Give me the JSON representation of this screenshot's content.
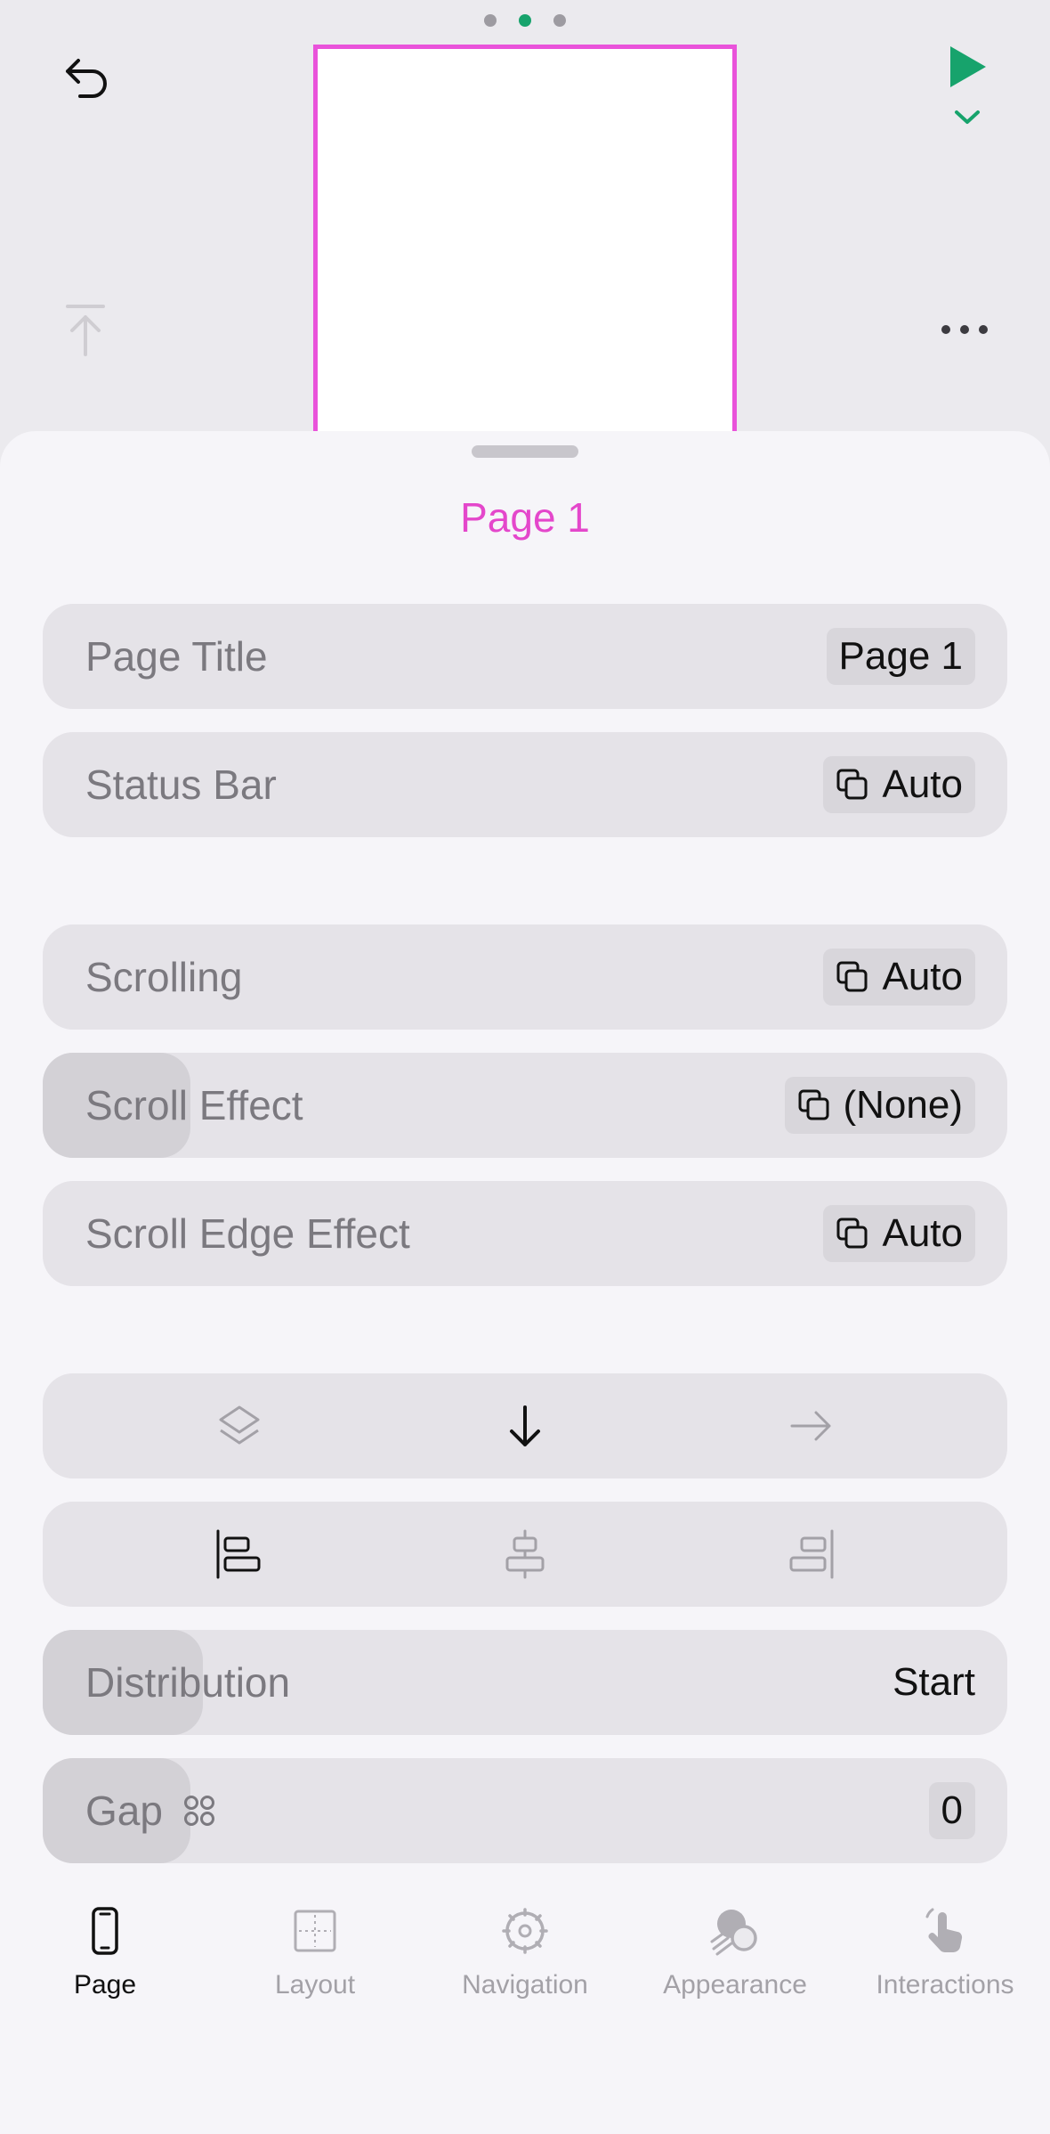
{
  "header": {
    "page_dots": [
      {
        "active": false
      },
      {
        "active": true
      },
      {
        "active": false
      }
    ],
    "undo_icon": "undo-arrow-icon",
    "play_icon": "play-icon",
    "export_icon": "arrow-up-to-line-icon",
    "more_icon": "ellipsis-icon"
  },
  "sheet": {
    "title": "Page 1",
    "page_title": {
      "label": "Page Title",
      "value": "Page 1"
    },
    "status_bar": {
      "label": "Status Bar",
      "value": "Auto"
    },
    "scrolling": {
      "label": "Scrolling",
      "value": "Auto"
    },
    "scroll_effect": {
      "label": "Scroll Effect",
      "value": "(None)"
    },
    "scroll_edge_effect": {
      "label": "Scroll Edge Effect",
      "value": "Auto"
    },
    "direction": {
      "options": [
        "stack-layers-icon",
        "arrow-down-icon",
        "arrow-right-icon"
      ],
      "selected": 1
    },
    "alignment": {
      "options": [
        "align-left-icon",
        "align-center-icon",
        "align-right-icon"
      ],
      "selected": 0
    },
    "distribution": {
      "label": "Distribution",
      "value": "Start"
    },
    "gap": {
      "label": "Gap",
      "value": "0"
    }
  },
  "tabs": [
    {
      "label": "Page",
      "icon": "phone-icon",
      "active": true
    },
    {
      "label": "Layout",
      "icon": "layout-grid-icon",
      "active": false
    },
    {
      "label": "Navigation",
      "icon": "navigation-gear-icon",
      "active": false
    },
    {
      "label": "Appearance",
      "icon": "appearance-icon",
      "active": false
    },
    {
      "label": "Interactions",
      "icon": "hand-tap-icon",
      "active": false
    }
  ],
  "colors": {
    "accent_pink": "#e447cb",
    "accent_green": "#17a36c",
    "frame_border": "#e953da"
  }
}
